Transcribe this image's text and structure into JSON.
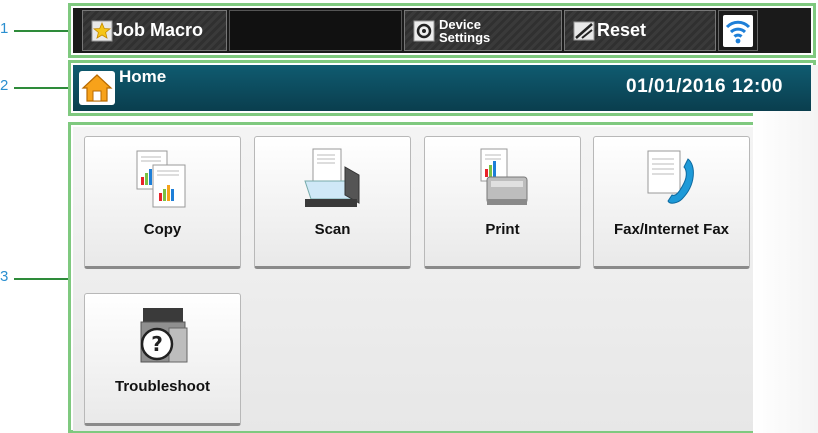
{
  "callouts": {
    "c1": "1",
    "c2": "2",
    "c3": "3"
  },
  "toolbar": {
    "job_macro_label": "Job Macro",
    "device_settings_line1": "Device",
    "device_settings_line2": "Settings",
    "reset_label": "Reset",
    "wifi_icon": "wifi-icon"
  },
  "header": {
    "title": "Home",
    "datetime": "01/01/2016 12:00"
  },
  "tiles": {
    "copy": "Copy",
    "scan": "Scan",
    "print": "Print",
    "fax": "Fax/Internet Fax",
    "troubleshoot": "Troubleshoot"
  },
  "colors": {
    "header_bg": "#0f5b70",
    "frame": "#7fc97f",
    "callout": "#2a8fd0",
    "wifi_bg": "#ffffff",
    "wifi_fg": "#1e7fd8"
  }
}
